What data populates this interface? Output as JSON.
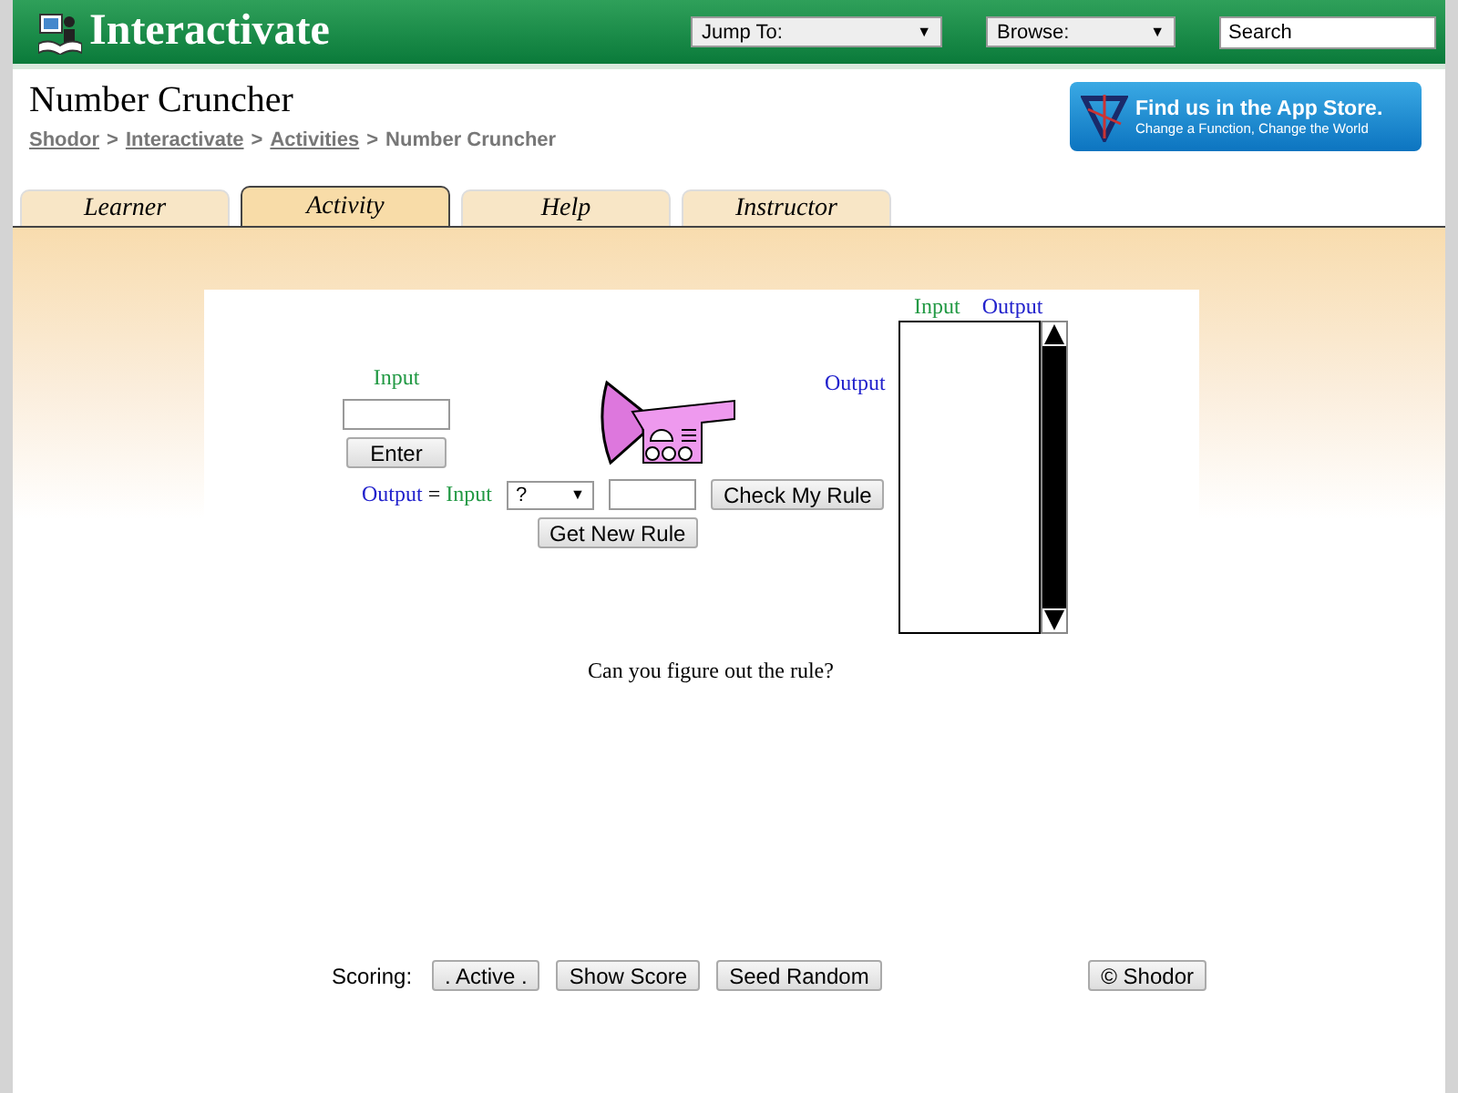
{
  "header": {
    "logo": "Interactivate",
    "jump_to": "Jump To:",
    "browse": "Browse:",
    "caret": "▼",
    "search": {
      "placeholder": "Search"
    }
  },
  "page": {
    "title": "Number Cruncher",
    "breadcrumb": [
      {
        "label": "Shodor",
        "link": true
      },
      {
        "label": "Interactivate",
        "link": true
      },
      {
        "label": "Activities",
        "link": true
      },
      {
        "label": "Number Cruncher",
        "link": false
      }
    ],
    "separator": ">"
  },
  "app_store": {
    "title": "Find us in the App Store.",
    "subtitle": "Change a Function, Change the World"
  },
  "tabs": [
    {
      "label": "Learner",
      "selected": false
    },
    {
      "label": "Activity",
      "selected": true
    },
    {
      "label": "Help",
      "selected": false
    },
    {
      "label": "Instructor",
      "selected": false
    }
  ],
  "applet": {
    "input_label": "Input",
    "enter_button": "Enter",
    "output_label": "Output",
    "rule_output": "Output",
    "rule_equals": "=",
    "rule_input": "Input",
    "operator": "?",
    "check_button": "Check My Rule",
    "new_rule_button": "Get New Rule",
    "table_headers": [
      "Input",
      "Output"
    ],
    "prompt": "Can you figure out the rule?"
  },
  "scoring": {
    "label": "Scoring:",
    "buttons": [
      ". Active .",
      "Show Score",
      "Seed Random"
    ],
    "copyright": "© Shodor"
  }
}
